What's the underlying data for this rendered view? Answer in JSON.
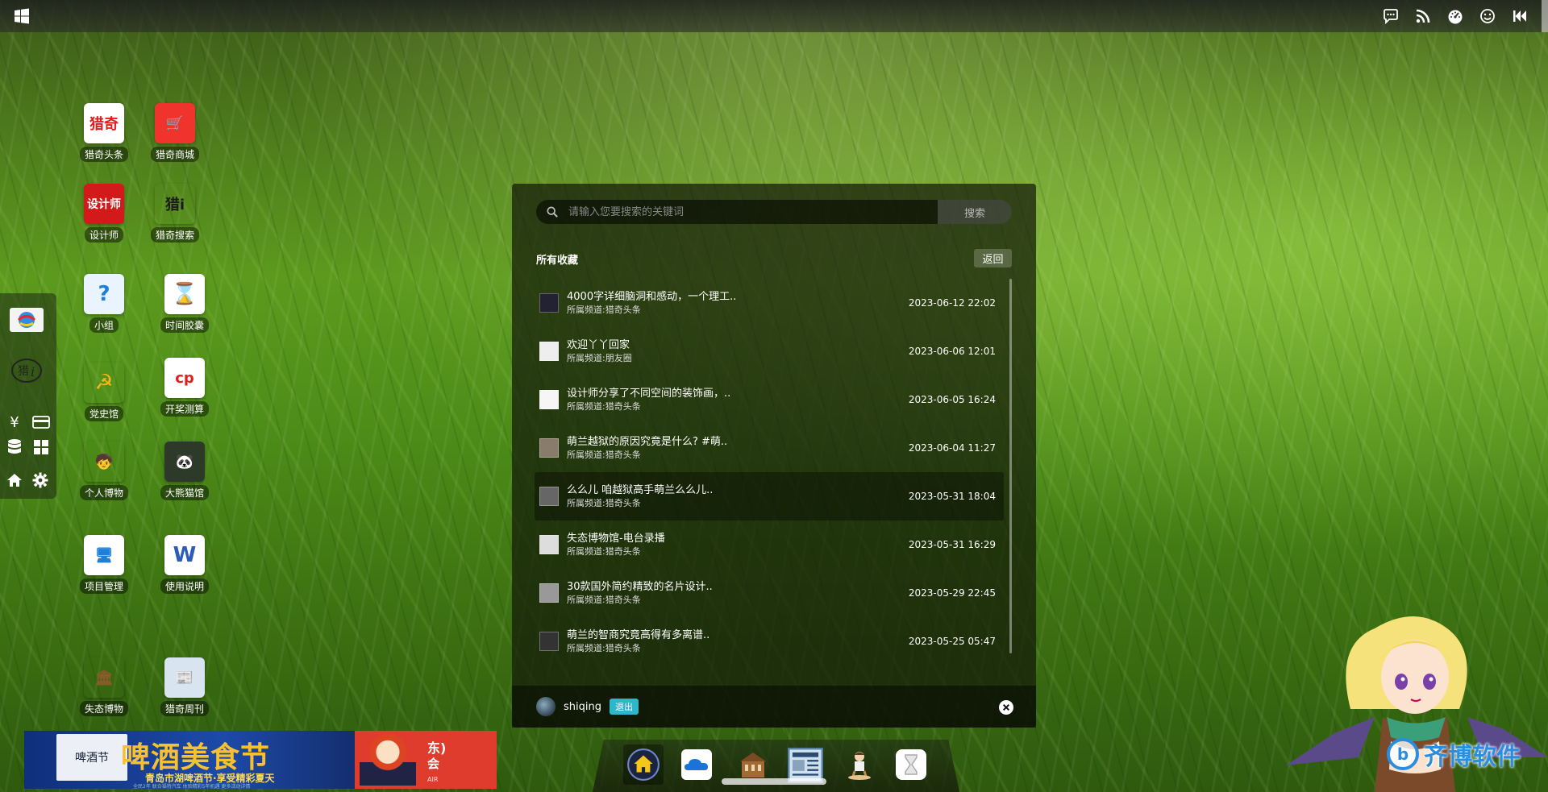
{
  "topbar": {
    "start_icon": "windows-icon",
    "right_icons": [
      "chat-icon",
      "rss-icon",
      "dashboard-icon",
      "smiley-icon",
      "rewind-icon"
    ]
  },
  "desktop_icons": [
    {
      "name": "猎奇头条",
      "icon": "news-app-icon",
      "glyph": "猎奇",
      "bg": "#ffffff",
      "fg": "#e01e1e"
    },
    {
      "name": "猎奇商城",
      "icon": "shopping-cart-icon",
      "glyph": "🛒",
      "bg": "#f0342d",
      "fg": "#ffffff"
    },
    {
      "name": "设计师",
      "icon": "designer-app-icon",
      "glyph": "设计师",
      "bg": "#d21a1a",
      "fg": "#ffffff"
    },
    {
      "name": "猎奇搜索",
      "icon": "search-app-icon",
      "glyph": "猎i",
      "bg": "transparent",
      "fg": "#1b1b1b"
    },
    {
      "name": "小组",
      "icon": "help-bubble-icon",
      "glyph": "?",
      "bg": "#eaf4ff",
      "fg": "#1e7fd8"
    },
    {
      "name": "时间胶囊",
      "icon": "hourglass-icon",
      "glyph": "⌛",
      "bg": "#ffffff",
      "fg": "#888888"
    },
    {
      "name": "党史馆",
      "icon": "hammer-sickle-icon",
      "glyph": "☭",
      "bg": "transparent",
      "fg": "#f2b41c"
    },
    {
      "name": "开奖测算",
      "icon": "lottery-app-icon",
      "glyph": "cp",
      "bg": "#ffffff",
      "fg": "#e01e1e"
    },
    {
      "name": "个人博物",
      "icon": "person-figure-icon",
      "glyph": "🧒",
      "bg": "transparent",
      "fg": "#ffffff"
    },
    {
      "name": "大熊猫馆",
      "icon": "panda-icon",
      "glyph": "🐼",
      "bg": "#2d3a2a",
      "fg": "#ffffff"
    },
    {
      "name": "项目管理",
      "icon": "monitor-icon",
      "glyph": "🖥",
      "bg": "#ffffff",
      "fg": "#1e7fd8"
    },
    {
      "name": "使用说明",
      "icon": "word-document-icon",
      "glyph": "W",
      "bg": "#ffffff",
      "fg": "#2b5cb8"
    },
    {
      "name": "失态博物",
      "icon": "museum-building-icon",
      "glyph": "🏛",
      "bg": "transparent",
      "fg": "#8a5a2a"
    },
    {
      "name": "猎奇周刊",
      "icon": "newspaper-icon",
      "glyph": "📰",
      "bg": "#d8e4ef",
      "fg": "#2a4a70"
    }
  ],
  "left_dock": {
    "items": [
      "globe-mail-icon",
      "lieqi-logo-icon",
      "yuan-icon",
      "card-icon",
      "database-icon",
      "windows-grid-icon",
      "home-icon",
      "settings-gear-icon"
    ],
    "yuan_glyph": "¥"
  },
  "panel": {
    "search_placeholder": "请输入您要搜索的关键词",
    "search_button": "搜索",
    "title": "所有收藏",
    "back_button": "返回",
    "items": [
      {
        "title": "4000字详细脑洞和感动，一个理工..",
        "channel": "所属频道:猎奇头条",
        "date": "2023-06-12 22:02",
        "thumb": "#223"
      },
      {
        "title": "欢迎丫丫回家",
        "channel": "所属频道:朋友圈",
        "date": "2023-06-06 12:01",
        "thumb": "#eee"
      },
      {
        "title": "设计师分享了不同空间的装饰画，..",
        "channel": "所属频道:猎奇头条",
        "date": "2023-06-05 16:24",
        "thumb": "#f6f6f6"
      },
      {
        "title": "萌兰越狱的原因究竟是什么? #萌..",
        "channel": "所属频道:猎奇头条",
        "date": "2023-06-04 11:27",
        "thumb": "#8a7c6a"
      },
      {
        "title": "么么儿 咱越狱高手萌兰么么儿..",
        "channel": "所属频道:猎奇头条",
        "date": "2023-05-31 18:04",
        "thumb": "#666"
      },
      {
        "title": "失态博物馆-电台录播",
        "channel": "所属频道:猎奇头条",
        "date": "2023-05-31 16:29",
        "thumb": "#ddd"
      },
      {
        "title": "30款国外简约精致的名片设计..",
        "channel": "所属频道:猎奇头条",
        "date": "2023-05-29 22:45",
        "thumb": "#999"
      },
      {
        "title": "萌兰的智商究竟高得有多离谱..",
        "channel": "所属频道:猎奇头条",
        "date": "2023-05-25 05:47",
        "thumb": "#333"
      }
    ],
    "active_index": 4,
    "user": "shiqing",
    "logout_button": "退出"
  },
  "ad": {
    "badge": "啤酒节",
    "headline": "啤酒美食节",
    "subline": "青岛市湖啤酒节·享受精彩夏天",
    "small_print": "全民2年 联合福特汽车 体验精彩5年机遇 更多活动详情",
    "right_line1": "东)",
    "right_line2": "会",
    "right_line3": "AIR"
  },
  "dock": {
    "items": [
      "home-icon",
      "cloud-icon",
      "museum-building-icon",
      "newspaper-icon",
      "person-figure-icon",
      "hourglass-icon"
    ]
  },
  "watermark": {
    "logo_letter": "b",
    "text": "齐博软件"
  },
  "colors": {
    "accent_logout": "#2db7c9",
    "panel_bg": "rgba(20,25,10,0.72)",
    "watermark_blue": "#2a8ee0"
  }
}
